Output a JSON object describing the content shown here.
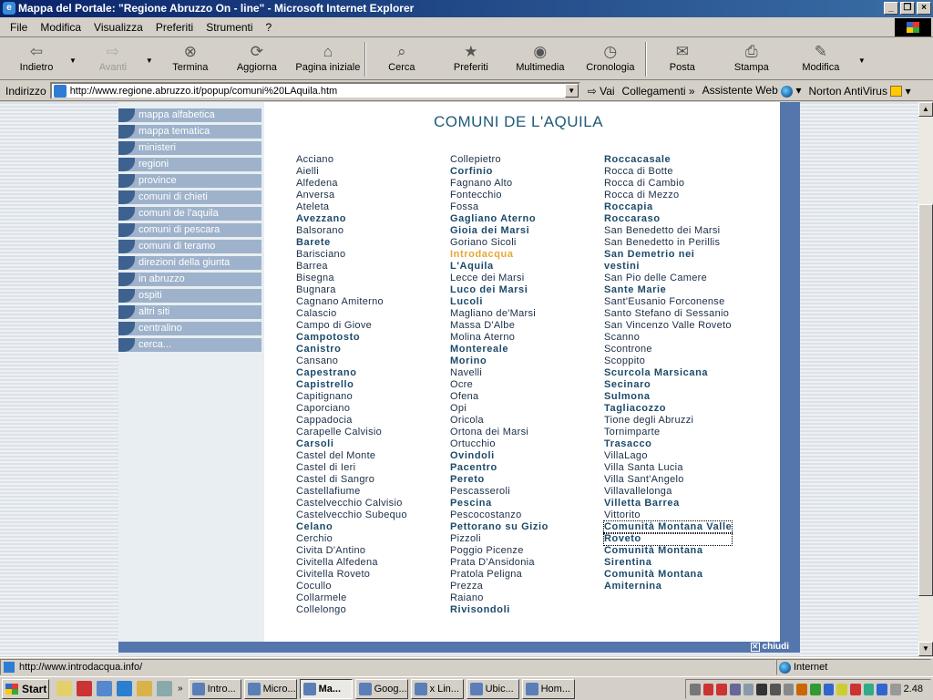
{
  "window": {
    "title": "Mappa del Portale: \"Regione Abruzzo On - line\" - Microsoft Internet Explorer"
  },
  "menu": [
    "File",
    "Modifica",
    "Visualizza",
    "Preferiti",
    "Strumenti",
    "?"
  ],
  "toolbar": {
    "back": "Indietro",
    "forward": "Avanti",
    "stop": "Termina",
    "refresh": "Aggiorna",
    "home": "Pagina iniziale",
    "search": "Cerca",
    "favorites": "Preferiti",
    "media": "Multimedia",
    "history": "Cronologia",
    "mail": "Posta",
    "print": "Stampa",
    "edit": "Modifica"
  },
  "address": {
    "label": "Indirizzo",
    "url": "http://www.regione.abruzzo.it/popup/comuni%20LAquila.htm",
    "go": "Vai",
    "links": "Collegamenti",
    "assistant": "Assistente Web",
    "norton": "Norton AntiVirus"
  },
  "sidebar": [
    "mappa alfabetica",
    "mappa tematica",
    "ministeri",
    "regioni",
    "province",
    "comuni di chieti",
    "comuni de l'aquila",
    "comuni di pescara",
    "comuni di teramo",
    "direzioni della giunta",
    "in abruzzo",
    "ospiti",
    "altri siti",
    "centralino",
    "cerca..."
  ],
  "page": {
    "heading": "COMUNI DE L'AQUILA",
    "close": "chiudi",
    "col1": [
      {
        "t": "Acciano"
      },
      {
        "t": "Aielli"
      },
      {
        "t": "Alfedena"
      },
      {
        "t": "Anversa"
      },
      {
        "t": "Ateleta"
      },
      {
        "t": "Avezzano",
        "s": "b"
      },
      {
        "t": "Balsorano"
      },
      {
        "t": "Barete",
        "s": "b"
      },
      {
        "t": "Barisciano"
      },
      {
        "t": "Barrea"
      },
      {
        "t": "Bisegna"
      },
      {
        "t": "Bugnara"
      },
      {
        "t": "Cagnano Amiterno"
      },
      {
        "t": "Calascio"
      },
      {
        "t": "Campo di Giove"
      },
      {
        "t": "Campotosto",
        "s": "b"
      },
      {
        "t": "Canistro",
        "s": "b"
      },
      {
        "t": "Cansano"
      },
      {
        "t": "Capestrano",
        "s": "b"
      },
      {
        "t": "Capistrello",
        "s": "b"
      },
      {
        "t": "Capitignano"
      },
      {
        "t": "Caporciano"
      },
      {
        "t": "Cappadocia"
      },
      {
        "t": "Carapelle Calvisio"
      },
      {
        "t": "Carsoli",
        "s": "b"
      },
      {
        "t": "Castel del Monte"
      },
      {
        "t": "Castel di Ieri"
      },
      {
        "t": "Castel di Sangro"
      },
      {
        "t": "Castellafiume"
      },
      {
        "t": "Castelvecchio Calvisio"
      },
      {
        "t": "Castelvecchio Subequo"
      },
      {
        "t": "Celano",
        "s": "b"
      },
      {
        "t": "Cerchio"
      },
      {
        "t": "Civita D'Antino"
      },
      {
        "t": "Civitella Alfedena"
      },
      {
        "t": "Civitella Roveto"
      },
      {
        "t": "Cocullo"
      },
      {
        "t": "Collarmele"
      },
      {
        "t": "Collelongo"
      }
    ],
    "col2": [
      {
        "t": "Collepietro"
      },
      {
        "t": "Corfinio",
        "s": "b"
      },
      {
        "t": "Fagnano Alto"
      },
      {
        "t": "Fontecchio"
      },
      {
        "t": "Fossa"
      },
      {
        "t": "Gagliano Aterno",
        "s": "b"
      },
      {
        "t": "Gioia dei Marsi",
        "s": "b"
      },
      {
        "t": "Goriano Sicoli"
      },
      {
        "t": "Introdacqua",
        "s": "hl"
      },
      {
        "t": "L'Aquila",
        "s": "b"
      },
      {
        "t": "Lecce dei Marsi"
      },
      {
        "t": "Luco dei Marsi",
        "s": "b"
      },
      {
        "t": "Lucoli",
        "s": "b"
      },
      {
        "t": "Magliano de'Marsi"
      },
      {
        "t": "Massa D'Albe"
      },
      {
        "t": "Molina Aterno"
      },
      {
        "t": "Montereale",
        "s": "b"
      },
      {
        "t": "Morino",
        "s": "b"
      },
      {
        "t": "Navelli"
      },
      {
        "t": "Ocre"
      },
      {
        "t": "Ofena"
      },
      {
        "t": "Opi"
      },
      {
        "t": "Oricola"
      },
      {
        "t": "Ortona dei Marsi"
      },
      {
        "t": "Ortucchio"
      },
      {
        "t": "Ovindoli",
        "s": "b"
      },
      {
        "t": "Pacentro",
        "s": "b"
      },
      {
        "t": "Pereto",
        "s": "b"
      },
      {
        "t": "Pescasseroli"
      },
      {
        "t": "Pescina",
        "s": "b"
      },
      {
        "t": "Pescocostanzo"
      },
      {
        "t": "Pettorano su Gizio",
        "s": "b"
      },
      {
        "t": "Pizzoli"
      },
      {
        "t": "Poggio Picenze"
      },
      {
        "t": "Prata D'Ansidonia"
      },
      {
        "t": "Pratola Peligna"
      },
      {
        "t": "Prezza"
      },
      {
        "t": "Raiano"
      },
      {
        "t": "Rivisondoli",
        "s": "b"
      }
    ],
    "col3": [
      {
        "t": "Roccacasale",
        "s": "b"
      },
      {
        "t": "Rocca di Botte"
      },
      {
        "t": "Rocca di Cambio"
      },
      {
        "t": "Rocca di Mezzo"
      },
      {
        "t": "Roccapia",
        "s": "b"
      },
      {
        "t": "Roccaraso",
        "s": "b"
      },
      {
        "t": "San Benedetto dei Marsi"
      },
      {
        "t": "San Benedetto in Perillis"
      },
      {
        "t": "San Demetrio nei",
        "s": "b"
      },
      {
        "t": "vestini",
        "s": "b"
      },
      {
        "t": "San Pio delle Camere"
      },
      {
        "t": "Sante Marie",
        "s": "b"
      },
      {
        "t": "Sant'Eusanio Forconense"
      },
      {
        "t": "Santo Stefano di Sessanio"
      },
      {
        "t": "San Vincenzo Valle Roveto"
      },
      {
        "t": "Scanno"
      },
      {
        "t": "Scontrone"
      },
      {
        "t": "Scoppito"
      },
      {
        "t": "Scurcola Marsicana",
        "s": "b"
      },
      {
        "t": "Secinaro",
        "s": "b"
      },
      {
        "t": "Sulmona",
        "s": "b"
      },
      {
        "t": "Tagliacozzo",
        "s": "b"
      },
      {
        "t": "Tione degli Abruzzi"
      },
      {
        "t": "Tornimparte"
      },
      {
        "t": "Trasacco",
        "s": "b"
      },
      {
        "t": "VillaLago"
      },
      {
        "t": "Villa Santa Lucia"
      },
      {
        "t": "Villa Sant'Angelo"
      },
      {
        "t": "Villavallelonga"
      },
      {
        "t": "Villetta Barrea",
        "s": "b"
      },
      {
        "t": "Vittorito"
      },
      {
        "t": "Comunità Montana Valle",
        "s": "b focus"
      },
      {
        "t": "Roveto",
        "s": "b focus"
      },
      {
        "t": "Comunità Montana",
        "s": "b"
      },
      {
        "t": "Sirentina",
        "s": "b"
      },
      {
        "t": "Comunità Montana",
        "s": "b"
      },
      {
        "t": "Amiternina",
        "s": "b"
      }
    ]
  },
  "status": {
    "url": "http://www.introdacqua.info/",
    "zone": "Internet"
  },
  "taskbar": {
    "start": "Start",
    "tasks": [
      "Intro...",
      "Micro...",
      "Ma...",
      "Goog...",
      "x Lin...",
      "Ubic...",
      "Hom..."
    ],
    "active_index": 2,
    "clock": "2.48"
  },
  "colors": {
    "accent": "#5476ac",
    "title": "#1d5a78",
    "highlight": "#e6a634"
  }
}
